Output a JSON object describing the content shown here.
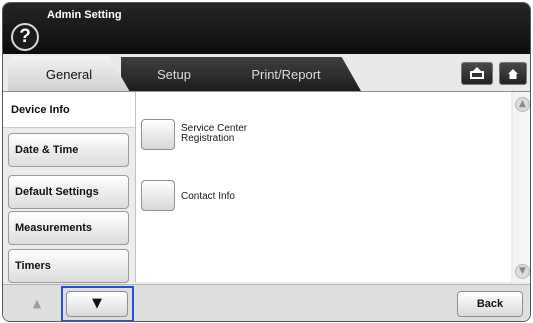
{
  "header": {
    "title": "Admin Setting",
    "help_glyph": "?"
  },
  "tabs": [
    {
      "label": "General",
      "selected": true
    },
    {
      "label": "Setup",
      "selected": false
    },
    {
      "label": "Print/Report",
      "selected": false
    }
  ],
  "header_icons": [
    "upload-icon",
    "home-icon"
  ],
  "sidebar": {
    "items": [
      {
        "label": "Device Info",
        "selected": true
      },
      {
        "label": "Date & Time",
        "selected": false
      },
      {
        "label": "Default Settings",
        "selected": false
      },
      {
        "label": "Measurements",
        "selected": false
      },
      {
        "label": "Timers",
        "selected": false
      }
    ]
  },
  "options": [
    {
      "label_line1": "Service Center",
      "label_line2": "Registration"
    },
    {
      "label_line1": "Contact Info",
      "label_line2": ""
    }
  ],
  "scroll": {
    "up_glyph": "▲",
    "down_glyph": "▼"
  },
  "paging": {
    "up_glyph": "▲",
    "down_glyph": "▼"
  },
  "footer": {
    "back_label": "Back"
  },
  "colors": {
    "focus_outline": "#2a4fd0",
    "header_bg": "#111111"
  }
}
